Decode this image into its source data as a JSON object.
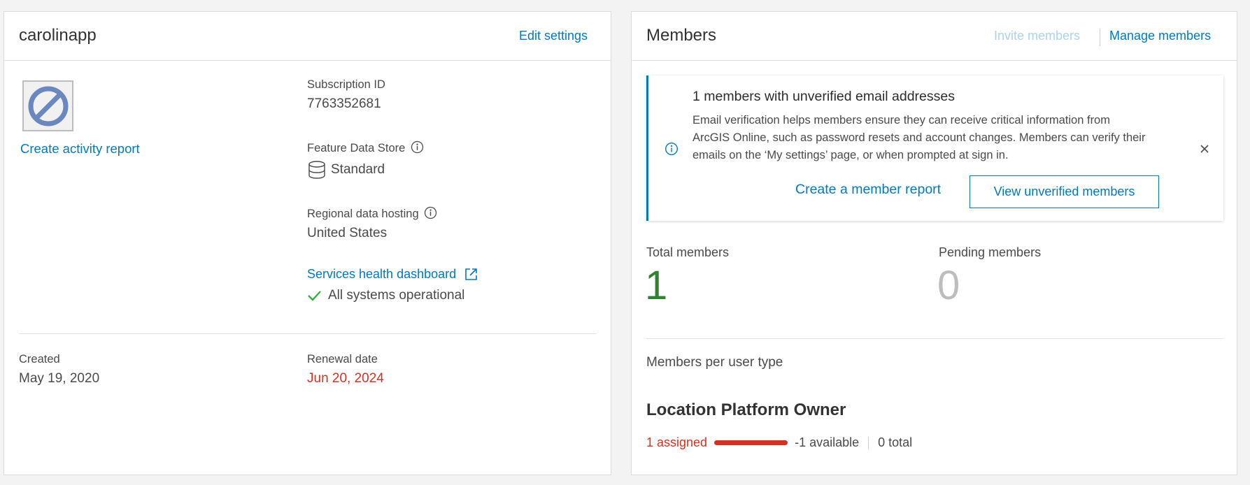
{
  "org": {
    "name": "carolinapp",
    "edit_settings": "Edit settings",
    "thumbnail_icon": "no-symbol-icon",
    "create_activity_report": "Create activity report",
    "subscription_id_label": "Subscription ID",
    "subscription_id": "7763352681",
    "feature_data_store_label": "Feature Data Store",
    "feature_data_store_value": "Standard",
    "regional_hosting_label": "Regional data hosting",
    "regional_hosting_value": "United States",
    "services_health_link": "Services health dashboard",
    "status_text": "All systems operational",
    "created_label": "Created",
    "created_value": "May 19, 2020",
    "renewal_label": "Renewal date",
    "renewal_value": "Jun 20, 2024"
  },
  "members": {
    "title": "Members",
    "invite_link": "Invite members",
    "manage_link": "Manage members",
    "notice": {
      "title": "1 members with unverified email addresses",
      "body": "Email verification helps members ensure they can receive critical information from ArcGIS Online, such as password resets and account changes. Members can verify their emails on the ‘My settings’ page, or when prompted at sign in.",
      "report_link": "Create a member report",
      "view_button": "View unverified members"
    },
    "total_label": "Total members",
    "total_value": "1",
    "pending_label": "Pending members",
    "pending_value": "0",
    "per_user_type_label": "Members per user type",
    "user_type": {
      "name": "Location Platform Owner",
      "assigned": "1 assigned",
      "assigned_fraction": 1.0,
      "available": "-1 available",
      "total": "0 total"
    }
  },
  "colors": {
    "link": "#0079c1",
    "link_disabled": "#a9d3ec",
    "renewal": "#d83020",
    "success": "#35ac46",
    "total_value": "#338033",
    "pending_value": "#bdbdbd"
  }
}
